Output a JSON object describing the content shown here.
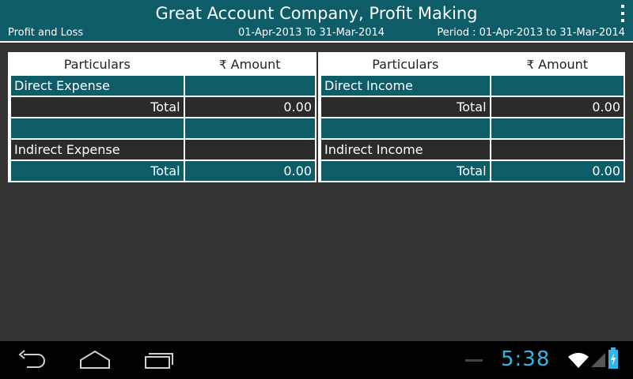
{
  "header": {
    "title": "Great Account Company, Profit Making",
    "report_name": "Profit and Loss",
    "date_range": "01-Apr-2013 To 31-Mar-2014",
    "period": "Period : 01-Apr-2013 to 31-Mar-2014"
  },
  "left_table": {
    "headers": [
      "Particulars",
      "Amount"
    ],
    "rows": [
      {
        "label": "Direct Expense",
        "amount": ""
      },
      {
        "label": "Total",
        "amount": "0.00"
      },
      {
        "label": "",
        "amount": ""
      },
      {
        "label": "Indirect Expense",
        "amount": ""
      },
      {
        "label": "Total",
        "amount": "0.00"
      }
    ]
  },
  "right_table": {
    "headers": [
      "Particulars",
      "Amount"
    ],
    "rows": [
      {
        "label": "Direct Income",
        "amount": ""
      },
      {
        "label": "Total",
        "amount": "0.00"
      },
      {
        "label": "",
        "amount": ""
      },
      {
        "label": "Indirect Income",
        "amount": ""
      },
      {
        "label": "Total",
        "amount": "0.00"
      }
    ]
  },
  "currency_symbol": "₹",
  "system_bar": {
    "clock": "5:38",
    "icons": [
      "back-icon",
      "home-icon",
      "recent-apps-icon",
      "wifi-icon",
      "signal-icon",
      "battery-icon"
    ]
  },
  "colors": {
    "accent": "#0e5c68",
    "background": "#333333",
    "clock": "#33b5e5"
  }
}
